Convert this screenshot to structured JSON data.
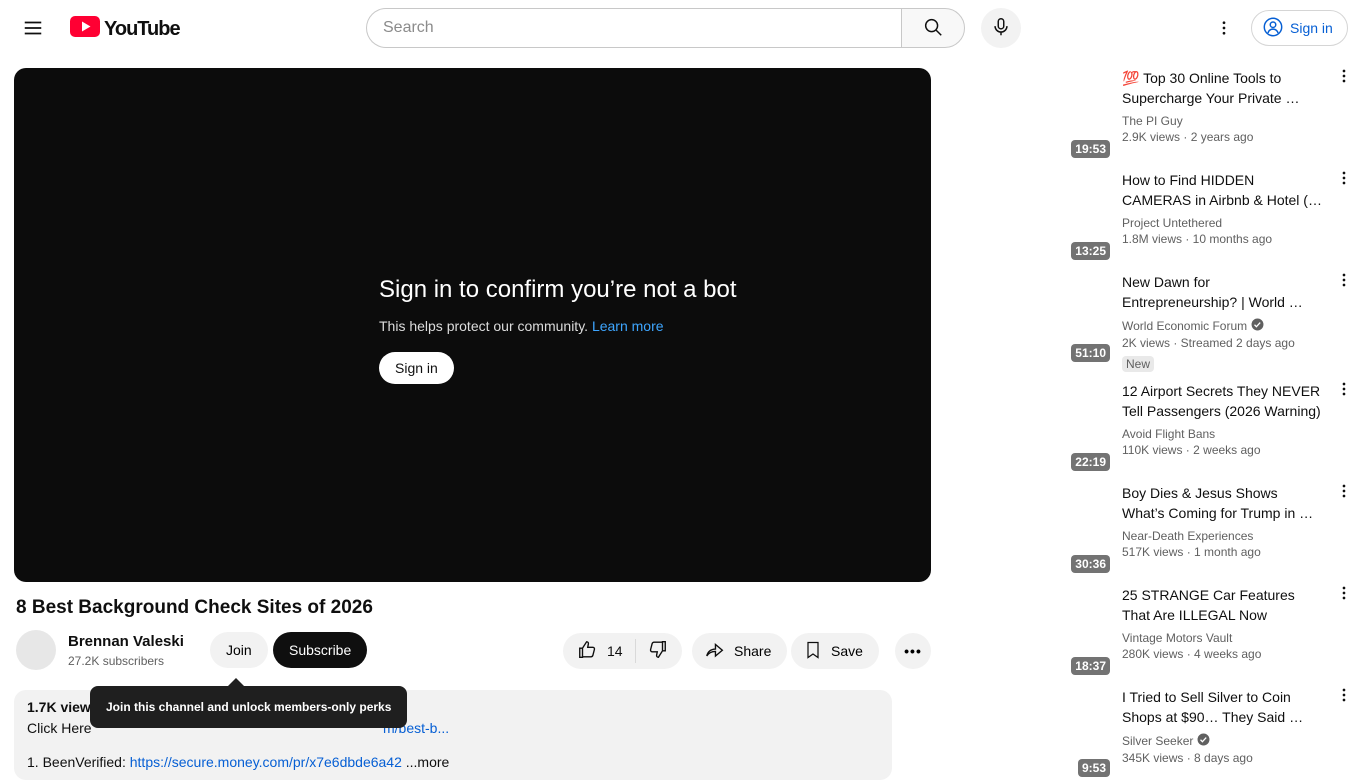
{
  "topbar": {
    "logo_text": "YouTube",
    "search_placeholder": "Search",
    "signin_label": "Sign in"
  },
  "player_overlay": {
    "title": "Sign in to confirm you’re not a bot",
    "subtitle": "This helps protect our community.",
    "learn_more": "Learn more",
    "signin_button": "Sign in"
  },
  "video": {
    "title": "8 Best Background Check Sites of 2026",
    "channel_name": "Brennan Valeski",
    "subscribers": "27.2K subscribers",
    "join_label": "Join",
    "subscribe_label": "Subscribe",
    "like_count": "14",
    "share_label": "Share",
    "save_label": "Save",
    "more_label": "•••"
  },
  "tooltip": {
    "text": "Join this channel and unlock members-only perks"
  },
  "description": {
    "line1_fragment": "1.7K view",
    "line2_prefix": "Click Here",
    "line2_link_fragment": "m/best-b...",
    "line3_prefix": "1. BeenVerified: ",
    "line3_link": "https://secure.money.com/pr/x7e6dbde6a42",
    "line3_more": " ...more"
  },
  "sidebar": {
    "new_badge_label": "New",
    "items": [
      {
        "title": "💯 Top 30 Online Tools to Supercharge Your Private …",
        "channel": "The PI Guy",
        "meta": "2.9K views · 2 years ago",
        "duration": "19:53",
        "verified": false,
        "is_new": false
      },
      {
        "title": "How to Find HIDDEN CAMERAS in Airbnb & Hotel (…",
        "channel": "Project Untethered",
        "meta": "1.8M views · 10 months ago",
        "duration": "13:25",
        "verified": false,
        "is_new": false
      },
      {
        "title": "New Dawn for Entrepreneurship?  | World …",
        "channel": "World Economic Forum",
        "meta": "2K views · Streamed 2 days ago",
        "duration": "51:10",
        "verified": true,
        "is_new": true
      },
      {
        "title": "12 Airport Secrets They NEVER Tell Passengers (2026 Warning)",
        "channel": "Avoid Flight Bans",
        "meta": "110K views · 2 weeks ago",
        "duration": "22:19",
        "verified": false,
        "is_new": false
      },
      {
        "title": "Boy Dies & Jesus Shows What’s Coming for Trump in …",
        "channel": "Near-Death Experiences",
        "meta": "517K views · 1 month ago",
        "duration": "30:36",
        "verified": false,
        "is_new": false
      },
      {
        "title": "25 STRANGE Car Features That Are ILLEGAL Now",
        "channel": "Vintage Motors Vault",
        "meta": "280K views · 4 weeks ago",
        "duration": "18:37",
        "verified": false,
        "is_new": false
      },
      {
        "title": "I Tried to Sell Silver to Coin Shops at $90… They Said …",
        "channel": "Silver Seeker",
        "meta": "345K views · 8 days ago",
        "duration": "9:53",
        "verified": true,
        "is_new": false
      }
    ]
  },
  "colors": {
    "accent_blue": "#065fd4",
    "player_link_blue": "#3ea6ff",
    "brand_red": "#FF0033",
    "muted_text": "#606060",
    "chip_gray": "#f2f2f2"
  }
}
